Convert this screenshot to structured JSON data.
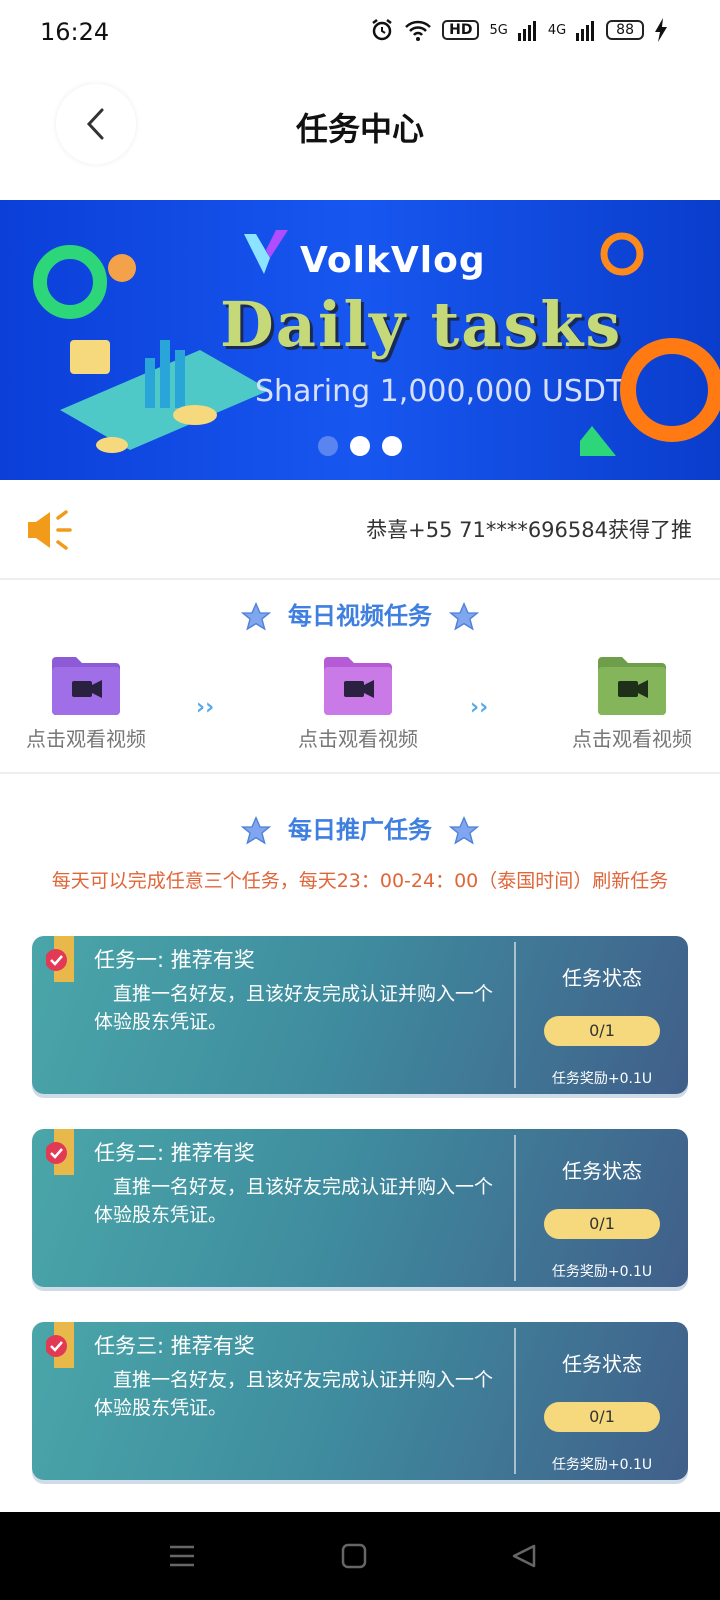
{
  "status_bar": {
    "time": "16:24",
    "hd_badge": "HD",
    "net_5g": "5G",
    "net_4g": "4G",
    "battery": "88"
  },
  "header": {
    "title": "任务中心",
    "back_icon": "chevron-left-icon"
  },
  "banner": {
    "brand": "VolkVlog",
    "title": "Daily tasks",
    "subtitle": "Sharing 1,000,000 USDT",
    "slides": 3,
    "active_slide": 1
  },
  "notice": {
    "icon": "megaphone-icon",
    "text": "恭喜+55 71****696584获得了推"
  },
  "video_tasks": {
    "heading": "每日视频任务",
    "items": [
      {
        "label": "点击观看视频",
        "color": "#8d5bd6"
      },
      {
        "label": "点击观看视频",
        "color": "#b65bd6"
      },
      {
        "label": "点击观看视频",
        "color": "#6f9e4a"
      }
    ],
    "arrow": "››"
  },
  "promo_tasks": {
    "heading": "每日推广任务",
    "note": "每天可以完成任意三个任务，每天23：00-24：00（泰国时间）刷新任务",
    "cards": [
      {
        "title": "任务一: 推荐有奖",
        "desc": "直推一名好友，且该好友完成认证并购入一个体验股东凭证。",
        "status_label": "任务状态",
        "progress": "0/1",
        "reward": "任务奖励+0.1U"
      },
      {
        "title": "任务二: 推荐有奖",
        "desc": "直推一名好友，且该好友完成认证并购入一个体验股东凭证。",
        "status_label": "任务状态",
        "progress": "0/1",
        "reward": "任务奖励+0.1U"
      },
      {
        "title": "任务三: 推荐有奖",
        "desc": "直推一名好友，且该好友完成认证并购入一个体验股东凭证。",
        "status_label": "任务状态",
        "progress": "0/1",
        "reward": "任务奖励+0.1U"
      }
    ]
  },
  "colors": {
    "accent_blue": "#3f7fe0",
    "banner_blue": "#1757f0",
    "note_orange": "#e0663a",
    "progress_yellow": "#f6d97c"
  }
}
